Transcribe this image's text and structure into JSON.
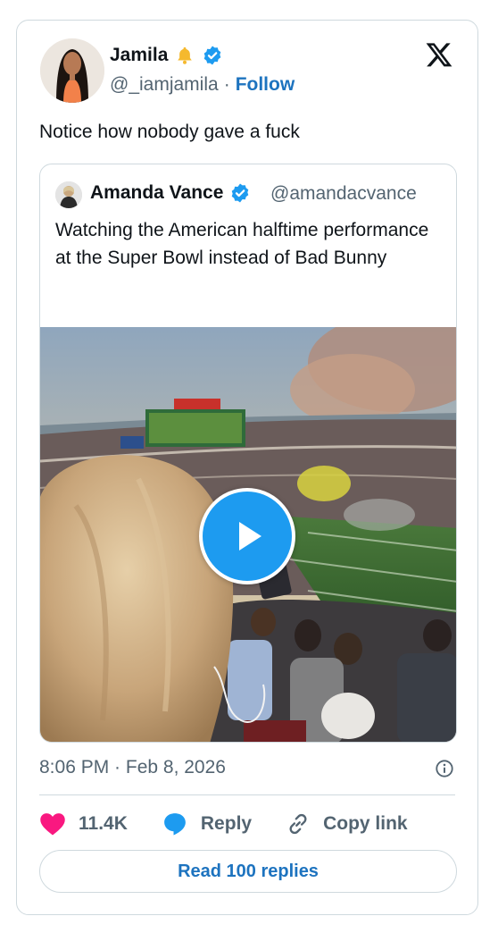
{
  "author": {
    "name": "Jamila",
    "handle": "@_iamjamila",
    "separator": "·",
    "follow_label": "Follow"
  },
  "tweet": {
    "text": "Notice how nobody gave a fuck",
    "timestamp": "8:06 PM · Feb 8, 2026"
  },
  "quoted": {
    "name": "Amanda Vance",
    "handle": "@amandacvance",
    "text": "Watching the American halftime performance at the Super Bowl instead of Bad Bunny"
  },
  "actions": {
    "likes": "11.4K",
    "reply_label": "Reply",
    "copy_label": "Copy link",
    "read_replies_label": "Read 100 replies"
  },
  "icons": {
    "like": "heart-icon",
    "reply": "speech-bubble-icon",
    "copy": "link-icon",
    "info": "info-icon",
    "brand": "x-logo-icon"
  },
  "colors": {
    "accent": "#1d9bf0",
    "link": "#1d73bf",
    "like": "#f91880",
    "muted": "#536471",
    "border": "#cfd9de"
  }
}
